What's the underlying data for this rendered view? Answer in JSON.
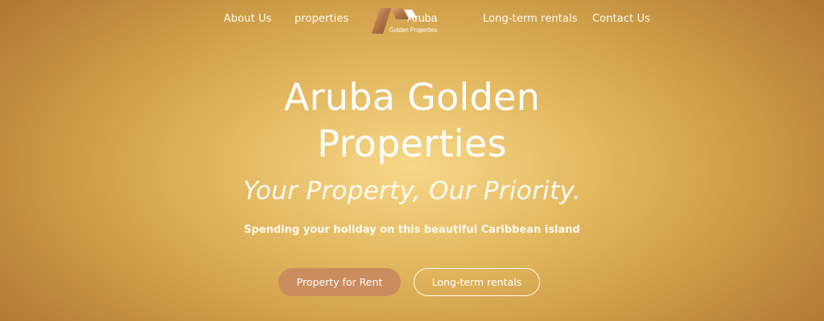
{
  "nav": {
    "links": [
      {
        "label": "About Us"
      },
      {
        "label": "properties"
      },
      {
        "label": "Long-term rentals"
      },
      {
        "label": "Contact Us"
      }
    ],
    "logo": {
      "name": "Aruba",
      "subtitle": "Golden Properties"
    }
  },
  "hero": {
    "title": "Aruba Golden Properties",
    "tagline": "Your Property, Our Priority.",
    "subline": "Spending your holiday on this beautiful Caribbean island",
    "buttons": {
      "primary": "Property for Rent",
      "secondary": "Long-term rentals"
    }
  },
  "colors": {
    "background_center": "#f6d887",
    "background_edge": "#b07a33",
    "primary_button": "#c88c5e",
    "text": "#ffffff"
  }
}
